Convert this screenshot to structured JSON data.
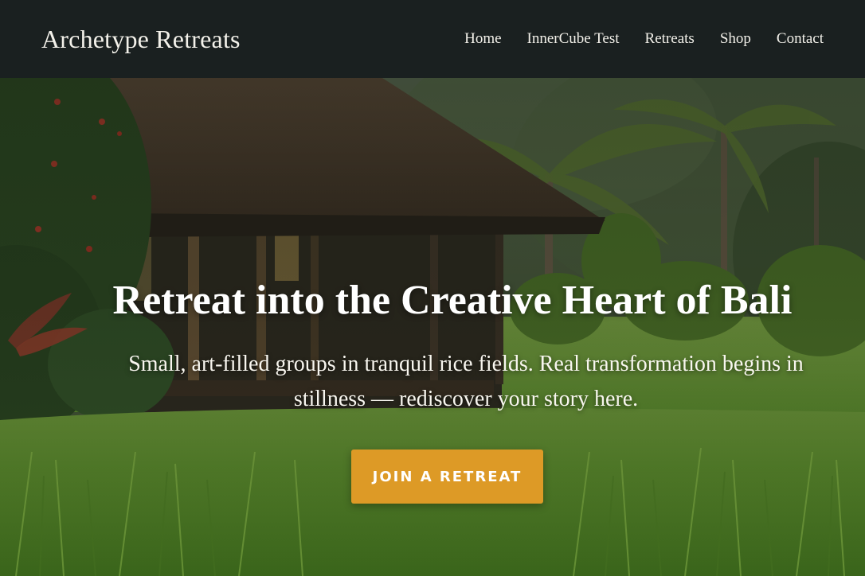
{
  "header": {
    "brand": "Archetype Retreats",
    "nav": [
      {
        "label": "Home"
      },
      {
        "label": "InnerCube Test"
      },
      {
        "label": "Retreats"
      },
      {
        "label": "Shop"
      },
      {
        "label": "Contact"
      }
    ]
  },
  "hero": {
    "title": "Retreat into the Creative Heart of Bali",
    "subtitle": "Small, art-filled groups in tranquil rice fields. Real transformation begins in stillness — rediscover your story here.",
    "cta_label": "JOIN A RETREAT",
    "image": "bali-hut-rice-field-photo"
  },
  "colors": {
    "header_bg": "#1a2020",
    "cta_bg": "#dd9a26",
    "text_light": "#f3f1ea"
  }
}
